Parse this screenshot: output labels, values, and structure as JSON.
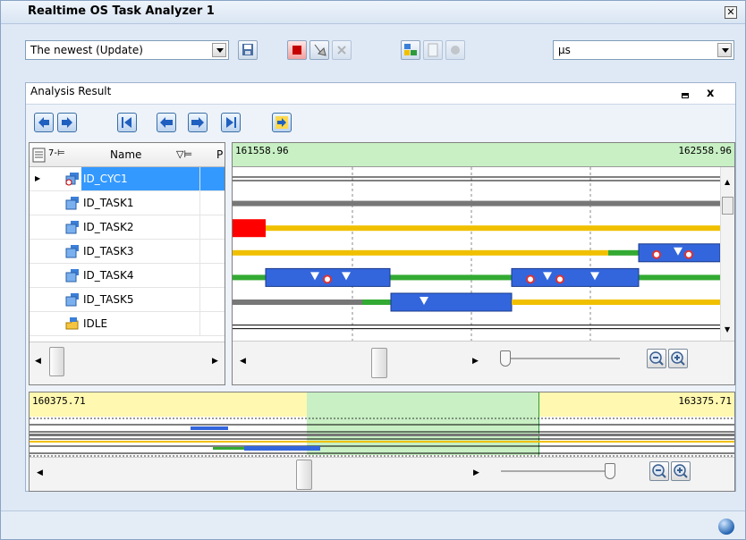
{
  "window": {
    "title": "Realtime OS Task Analyzer 1"
  },
  "toolbar": {
    "mode_select": "The newest (Update)",
    "unit_select": "μs"
  },
  "panel": {
    "title": "Analysis Result"
  },
  "task_list": {
    "header_name": "Name",
    "header_p": "P",
    "rows": [
      "ID_CYC1",
      "ID_TASK1",
      "ID_TASK2",
      "ID_TASK3",
      "ID_TASK4",
      "ID_TASK5",
      "IDLE"
    ]
  },
  "timeline": {
    "start": "161558.96",
    "end": "162558.96"
  },
  "overview": {
    "start": "160375.71",
    "end": "163375.71"
  },
  "colors": {
    "running": "#3366dd",
    "ready": "#f0c000",
    "waiting": "#33aa33",
    "suspended": "#777777",
    "interrupt": "#ff0000",
    "selected": "#3399ff"
  }
}
